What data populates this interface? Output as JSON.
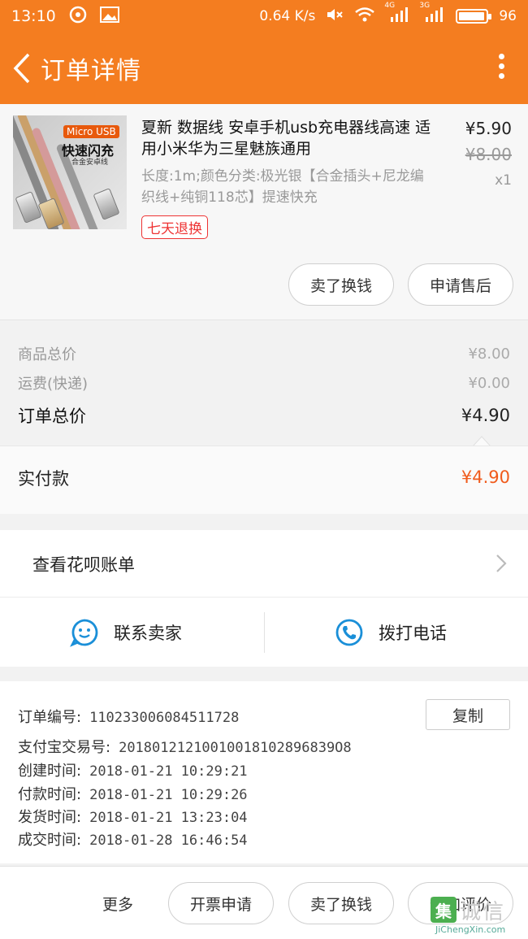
{
  "status_bar": {
    "time": "13:10",
    "net_speed": "0.64 K/s",
    "signal1_label": "4G",
    "signal2_label": "3G",
    "battery": "96",
    "battery_level": 0.96
  },
  "nav": {
    "title": "订单详情"
  },
  "product": {
    "thumb_banner": "Micro USB",
    "thumb_title": "快速闪充",
    "thumb_sub": "合金安卓线",
    "name": "夏新 数据线 安卓手机usb充电器线高速 适用小米华为三星魅族通用",
    "spec": "长度:1m;颜色分类:极光银【合金插头+尼龙编织线+纯铜118芯】提速快充",
    "tag": "七天退换",
    "price_now": "¥5.90",
    "price_old": "¥8.00",
    "qty": "x1",
    "btn_sell": "卖了换钱",
    "btn_aftersale": "申请售后"
  },
  "totals": {
    "goods_label": "商品总价",
    "goods_value": "¥8.00",
    "freight_label": "运费(快递)",
    "freight_value": "¥0.00",
    "order_label": "订单总价",
    "order_value": "¥4.90"
  },
  "paid": {
    "label": "实付款",
    "value": "¥4.90"
  },
  "huabei": {
    "label": "查看花呗账单"
  },
  "contact": {
    "seller": "联系卖家",
    "call": "拨打电话"
  },
  "info": {
    "order_no_label": "订单编号:",
    "order_no": "110233006084511728",
    "copy": "复制",
    "alipay_label": "支付宝交易号:",
    "alipay_no": "20180121210010018102896839O8",
    "created_label": "创建时间:",
    "created": "2018-01-21 10:29:21",
    "paid_label": "付款时间:",
    "paid": "2018-01-21 10:29:26",
    "shipped_label": "发货时间:",
    "shipped": "2018-01-21 13:23:04",
    "closed_label": "成交时间:",
    "closed": "2018-01-28 16:46:54"
  },
  "bottom": {
    "more": "更多",
    "invoice": "开票申请",
    "sell": "卖了换钱",
    "review": "追加评价"
  },
  "watermark": {
    "logo": "集",
    "cn": "诚信",
    "en": "JiChengXin.com"
  },
  "colors": {
    "brand": "#f47d20",
    "accent_price": "#f05b1c",
    "tag_red": "#ee3333",
    "contact_blue": "#1a8fd8"
  }
}
